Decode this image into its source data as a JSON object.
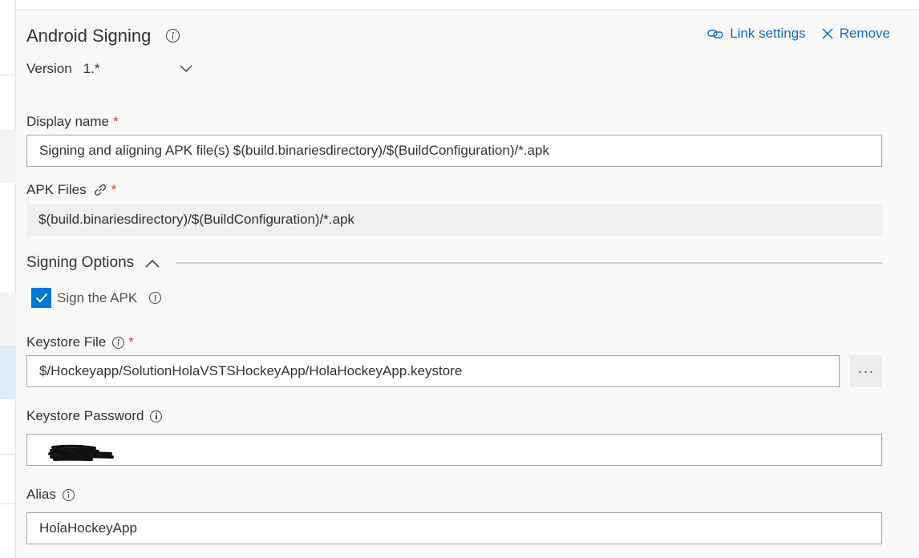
{
  "task": {
    "title": "Android Signing",
    "version_label": "Version",
    "version_value": "1.*"
  },
  "actions": {
    "link_settings": "Link settings",
    "remove": "Remove"
  },
  "display_name": {
    "label": "Display name",
    "required_mark": "*",
    "value": "Signing and aligning APK file(s) $(build.binariesdirectory)/$(BuildConfiguration)/*.apk"
  },
  "apk_files": {
    "label": "APK Files",
    "required_mark": "*",
    "value": "$(build.binariesdirectory)/$(BuildConfiguration)/*.apk"
  },
  "signing_options": {
    "title": "Signing Options",
    "sign_apk_label": "Sign the APK",
    "sign_apk_checked": true
  },
  "keystore_file": {
    "label": "Keystore File",
    "required_mark": "*",
    "value": "$/Hockeyapp/SolutionHolaVSTSHockeyApp/HolaHockeyApp.keystore",
    "browse_label": "···"
  },
  "keystore_password": {
    "label": "Keystore Password"
  },
  "alias": {
    "label": "Alias",
    "value": "HolaHockeyApp"
  },
  "colors": {
    "accent": "#0078d4",
    "link": "#106ebe",
    "required": "#c8392b"
  }
}
